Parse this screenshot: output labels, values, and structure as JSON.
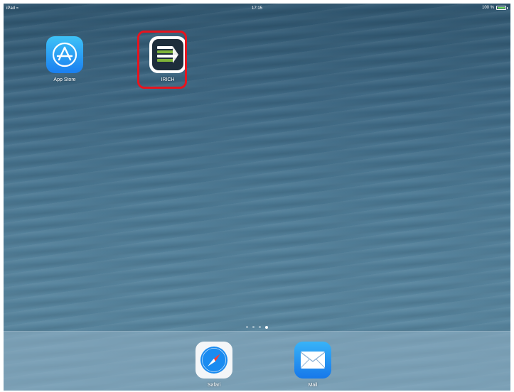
{
  "status_bar": {
    "device": "iPad",
    "time": "17:15",
    "battery_percent": "100 %",
    "battery_level": 1.0
  },
  "home_screen": {
    "apps": [
      {
        "label": "App Store",
        "icon": "app-store-icon"
      },
      {
        "label": "IRICH",
        "icon": "irich-icon",
        "highlighted": true
      }
    ],
    "page_count": 4,
    "active_page": 4,
    "highlight_color": "#e6141e"
  },
  "dock": {
    "apps": [
      {
        "label": "Safari",
        "icon": "safari-icon"
      },
      {
        "label": "Mail",
        "icon": "mail-icon"
      }
    ]
  },
  "colors": {
    "wallpaper": "#4b7994",
    "app_store": "#1a7ff0",
    "mail": "#1678ea",
    "irich_dark": "#1e2d3b",
    "irich_green": "#7fb539"
  }
}
